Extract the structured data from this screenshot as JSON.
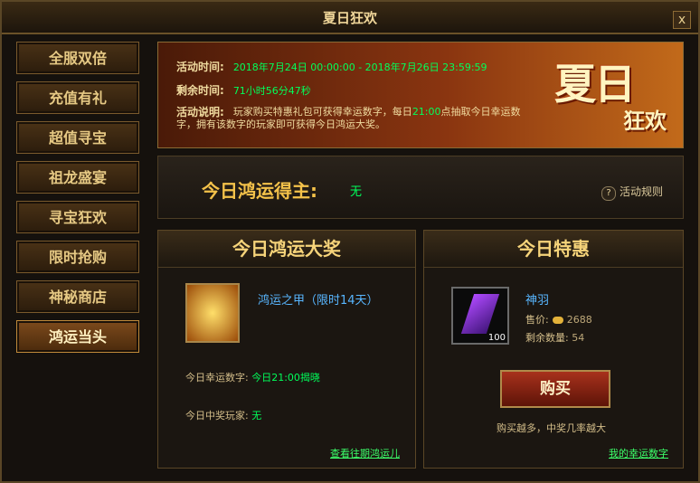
{
  "window": {
    "title": "夏日狂欢",
    "close": "x"
  },
  "sidebar": {
    "items": [
      {
        "label": "全服双倍"
      },
      {
        "label": "充值有礼"
      },
      {
        "label": "超值寻宝"
      },
      {
        "label": "祖龙盛宴"
      },
      {
        "label": "寻宝狂欢"
      },
      {
        "label": "限时抢购"
      },
      {
        "label": "神秘商店"
      },
      {
        "label": "鸿运当头"
      }
    ]
  },
  "banner": {
    "time_label": "活动时间:",
    "time_value": "2018年7月24日 00:00:00 - 2018年7月26日 23:59:59",
    "remain_label": "剩余时间:",
    "remain_value": "71小时56分47秒",
    "desc_label": "活动说明:",
    "desc_text_a": "玩家购买特惠礼包可获得幸运数字，每日",
    "desc_time": "21:00",
    "desc_text_b": "点抽取今日幸运数字，拥有该数字的玩家即可获得今日鸿运大奖。",
    "logo_big": "夏日",
    "logo_small": "狂欢"
  },
  "winner": {
    "label": "今日鸿运得主:",
    "value": "无",
    "rules": "活动规则",
    "rules_icon": "?"
  },
  "prize": {
    "title": "今日鸿运大奖",
    "item_name": "鸿运之甲（限时14天）",
    "lucky_label": "今日幸运数字:",
    "lucky_value": "今日21:00揭晓",
    "player_label": "今日中奖玩家:",
    "player_value": "无",
    "history_link": "查看往期鸿运儿"
  },
  "deal": {
    "title": "今日特惠",
    "item_name": "神羽",
    "item_qty": "100",
    "price_label": "售价:",
    "price_value": "2688",
    "stock_label": "剩余数量:",
    "stock_value": "54",
    "buy_label": "购买",
    "hint": "购买越多，中奖几率越大",
    "my_numbers_link": "我的幸运数字"
  }
}
